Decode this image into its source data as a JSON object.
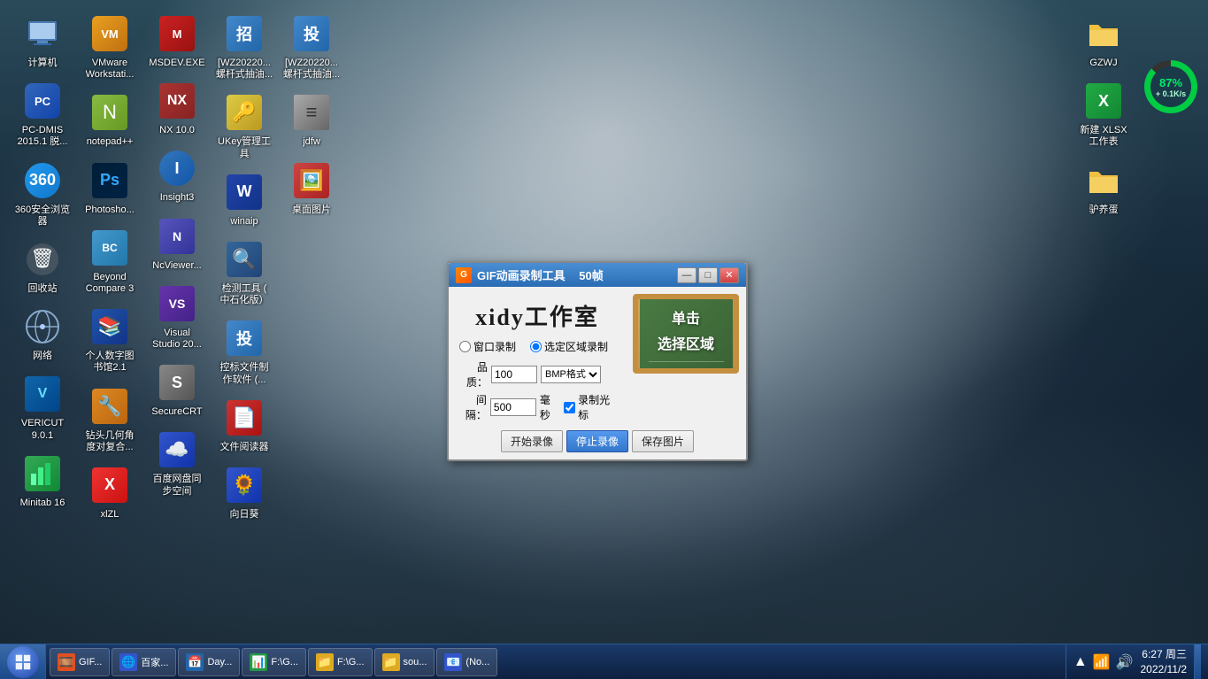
{
  "desktop": {
    "background": "cloudy dark teal",
    "icons_col1": [
      {
        "id": "computer",
        "label": "计算机",
        "icon": "🖥️"
      },
      {
        "id": "pcdmis",
        "label": "PC-DMIS\n2015.1 脱...",
        "icon": "📐"
      },
      {
        "id": "ie360",
        "label": "360安全浏览\n器",
        "icon": "🌐"
      },
      {
        "id": "recycle",
        "label": "回收站",
        "icon": "🗑️"
      },
      {
        "id": "network",
        "label": "网络",
        "icon": "🌐"
      },
      {
        "id": "vericut",
        "label": "VERICUT\n9.0.1",
        "icon": "V"
      },
      {
        "id": "minitab",
        "label": "Minitab 16",
        "icon": "📊"
      }
    ],
    "icons_col2": [
      {
        "id": "vmware",
        "label": "VMware\nWorkstati...",
        "icon": "V"
      },
      {
        "id": "notepad",
        "label": "notepad++",
        "icon": "N"
      },
      {
        "id": "photoshop",
        "label": "Photosho...",
        "icon": "Ps"
      },
      {
        "id": "beyondcompare",
        "label": "Beyond\nCompare 3",
        "icon": "BC"
      },
      {
        "id": "bookstore",
        "label": "个人数字图\n书馆2.1",
        "icon": "📚"
      },
      {
        "id": "drill",
        "label": "钻头几何角\n度对复合...",
        "icon": "🔧"
      },
      {
        "id": "xlzl",
        "label": "xlZL",
        "icon": "X"
      }
    ],
    "icons_col3": [
      {
        "id": "msdev",
        "label": "MSDEV.EXE",
        "icon": "M"
      },
      {
        "id": "nx",
        "label": "NX 10.0",
        "icon": "NX"
      },
      {
        "id": "insight3",
        "label": "Insight3",
        "icon": "I"
      },
      {
        "id": "ncviewer",
        "label": "NcViewer...",
        "icon": "N"
      },
      {
        "id": "vstudio",
        "label": "Visual\nStudio 20...",
        "icon": "VS"
      },
      {
        "id": "securecrt",
        "label": "SecureCRT",
        "icon": "S"
      },
      {
        "id": "baidu",
        "label": "百度网盘同\n步空间",
        "icon": "☁️"
      }
    ],
    "icons_col4": [
      {
        "id": "wz1",
        "label": "[WZ20220...\n螺杆式抽油...",
        "icon": "招"
      },
      {
        "id": "ukey",
        "label": "UKey管理工\n具",
        "icon": "🔑"
      },
      {
        "id": "winaip",
        "label": "winaip",
        "icon": "W"
      },
      {
        "id": "jctool",
        "label": "检测工具 (\n中石化版）",
        "icon": "🔍"
      },
      {
        "id": "pointer",
        "label": "控标文件制\n作软件 (...",
        "icon": "招"
      },
      {
        "id": "reader",
        "label": "文件阅读器",
        "icon": "📄"
      },
      {
        "id": "xrj",
        "label": "向日葵",
        "icon": "🌻"
      }
    ],
    "icons_col5": [
      {
        "id": "wz2",
        "label": "[WZ20220...\n螺杆式抽油...",
        "icon": "投"
      },
      {
        "id": "jdfw",
        "label": "jdfw",
        "icon": "≡"
      },
      {
        "id": "imgviewer",
        "label": "桌面图片",
        "icon": "🖼️"
      },
      {
        "id": "empty1",
        "label": "",
        "icon": ""
      },
      {
        "id": "empty2",
        "label": "",
        "icon": ""
      },
      {
        "id": "empty3",
        "label": "",
        "icon": ""
      },
      {
        "id": "empty4",
        "label": "",
        "icon": ""
      }
    ],
    "icons_right": [
      {
        "id": "gzwj",
        "label": "GZWJ",
        "icon": "📁"
      },
      {
        "id": "xlsx",
        "label": "新建 XLSX\n工作表",
        "icon": "X"
      },
      {
        "id": "donkey",
        "label": "驴养蛋",
        "icon": "📁"
      }
    ]
  },
  "gif_dialog": {
    "title": "GIF动画录制工具",
    "frame_count": "50帧",
    "logo_text": "xidy工作室",
    "radio_options": [
      "窗口录制",
      "选定区域录制"
    ],
    "selected_radio": 1,
    "quality_label": "品质：",
    "quality_value": "100",
    "format_label": "BMP格式",
    "interval_label": "间隔：",
    "interval_value": "500",
    "interval_unit": "毫秒",
    "cursor_checkbox": "录制光标",
    "cursor_checked": true,
    "board_line1": "单击",
    "board_line2": "选择区域",
    "btn_start": "开始录像",
    "btn_stop": "停止录像",
    "btn_save": "保存图片",
    "window_controls": [
      "—",
      "□",
      "✕"
    ]
  },
  "taskbar": {
    "apps": [
      {
        "id": "gif",
        "label": "GIF...",
        "icon": "🎞️",
        "color": "#e05020"
      },
      {
        "id": "baidu2",
        "label": "百家...",
        "icon": "🌐",
        "color": "#3355cc"
      },
      {
        "id": "day",
        "label": "Day...",
        "icon": "📅",
        "color": "#2266aa"
      },
      {
        "id": "fag1",
        "label": "F:\\G...",
        "icon": "📊",
        "color": "#229944"
      },
      {
        "id": "fag2",
        "label": "F:\\G...",
        "icon": "📁",
        "color": "#ddaa22"
      },
      {
        "id": "source",
        "label": "sou...",
        "icon": "📁",
        "color": "#ddaa22"
      },
      {
        "id": "no",
        "label": "(No...",
        "icon": "📧",
        "color": "#3355cc"
      }
    ],
    "tray": {
      "arrow": "▲",
      "signal_bars": "📶",
      "volume": "🔊",
      "datetime": "6:27 周三\n2022/11/2"
    }
  },
  "net_indicator": {
    "percent": "87%",
    "speed": "+ 0.1K/s"
  }
}
